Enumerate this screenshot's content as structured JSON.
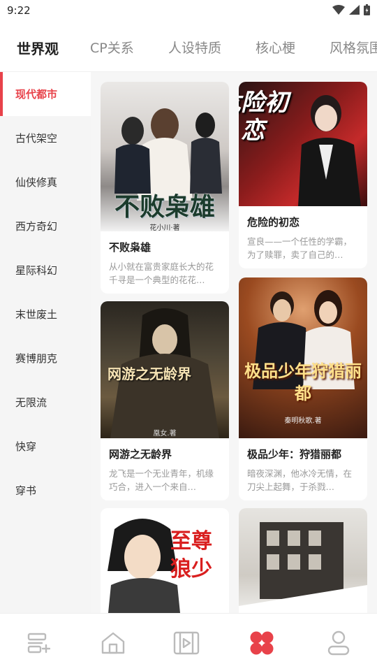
{
  "status": {
    "time": "9:22"
  },
  "top_tabs": [
    "世界观",
    "CP关系",
    "人设特质",
    "核心梗",
    "风格氛围"
  ],
  "sidebar": {
    "items": [
      "现代都市",
      "古代架空",
      "仙侠修真",
      "西方奇幻",
      "星际科幻",
      "末世废土",
      "赛博朋克",
      "无限流",
      "快穿",
      "穿书"
    ]
  },
  "books": [
    {
      "title": "不败枭雄",
      "desc": "从小就在富贵家庭长大的花千寻是一个典型的花花…",
      "cover_title": "不败枭雄",
      "cover_author": "花小川·著"
    },
    {
      "title": "危险的初恋",
      "desc": "宣良——一个任性的学霸，为了赎罪，卖了自己的…",
      "cover_title": "危险初恋",
      "cover_author": ""
    },
    {
      "title": "网游之无龄界",
      "desc": "龙飞是一个无业青年，机缘巧合，进入一个来自…",
      "cover_title": "网游之无龄界",
      "cover_author": "凰女.著"
    },
    {
      "title": "极品少年：狩猎丽都",
      "desc": "暗夜深渊，他冰冷无情，在刀尖上起舞，于杀戮…",
      "cover_title": "极品少年狩猎丽都",
      "cover_author": "秦明秋歌.著"
    },
    {
      "title": "",
      "desc": "",
      "cover_title": "至尊狼少",
      "cover_author": ""
    },
    {
      "title": "",
      "desc": "",
      "cover_title": "",
      "cover_author": ""
    }
  ],
  "colors": {
    "accent": "#e8424a",
    "sidebar_bg": "#f5f5f5",
    "content_bg": "#f6f6f6"
  },
  "bottom_nav": {
    "items": [
      {
        "icon": "bookshelf-add-icon",
        "active": false
      },
      {
        "icon": "home-icon",
        "active": false
      },
      {
        "icon": "video-icon",
        "active": false
      },
      {
        "icon": "category-icon",
        "active": true
      },
      {
        "icon": "profile-icon",
        "active": false
      }
    ]
  }
}
